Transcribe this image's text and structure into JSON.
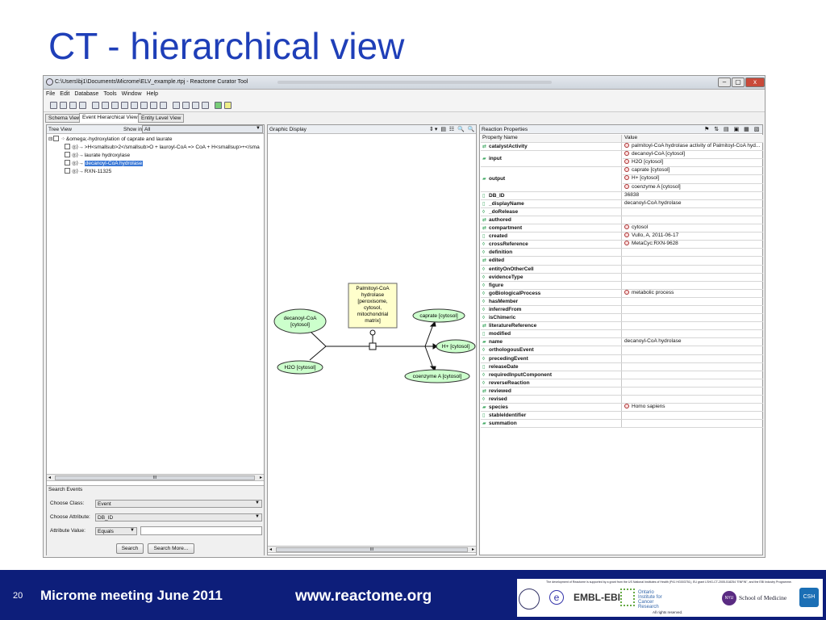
{
  "slide": {
    "title": "CT - hierarchical view",
    "page_number": "20",
    "meeting": "Microme meeting June 2011",
    "url": "www.reactome.org"
  },
  "window": {
    "title": "C:\\Users\\bj1\\Documents\\Microme\\ELV_example.rtpj - Reactome Curator Tool",
    "min": "–",
    "max": "▢",
    "close": "x"
  },
  "menu": [
    "File",
    "Edit",
    "Database",
    "Tools",
    "Window",
    "Help"
  ],
  "tabs": [
    "Schema View",
    "Event Hierarchical View",
    "Entity Level View"
  ],
  "tree_view": {
    "header": "Tree View",
    "show_in_label": "Show in",
    "show_in_value": "All",
    "items": [
      {
        "label": "&omega;-hydroxylation of caprate and laurate",
        "level": 0,
        "selected": false
      },
      {
        "label": ">H<smallsub>2</smallsub>O + lauroyl-CoA => CoA + H<smallsup>+</sma",
        "level": 1,
        "selected": false
      },
      {
        "label": "laurate hydroxylase",
        "level": 1,
        "selected": false
      },
      {
        "label": "decanoyl-CoA hydrolase",
        "level": 1,
        "selected": true
      },
      {
        "label": "RXN-11325",
        "level": 1,
        "selected": false
      }
    ],
    "scroll_thumb": "III"
  },
  "search": {
    "title": "Search Events",
    "class_label": "Choose Class:",
    "class_value": "Event",
    "attr_label": "Choose Attribute:",
    "attr_value": "DB_ID",
    "value_label": "Attribute Value:",
    "operator": "Equals",
    "value": "",
    "search_btn": "Search",
    "search_more_btn": "Search More..."
  },
  "graphic": {
    "header": "Graphic Display",
    "scroll_thumb": "III",
    "nodes": {
      "catalyst": [
        "Palmitoyl-CoA",
        "hydrolase",
        "[peroxisome,",
        "cytosol,",
        "mitochondrial",
        "matrix]"
      ],
      "input1": [
        "decanoyl-CoA",
        "[cytosol]"
      ],
      "input2": "H2O [cytosol]",
      "output1": "caprate [cytosol]",
      "output2": "H+ [cytosol]",
      "output3": "coenzyme A [cytosol]"
    }
  },
  "properties": {
    "header": "Reaction Properties",
    "col_name": "Property Name",
    "col_value": "Value",
    "rows": [
      {
        "name": "catalystActivity",
        "icon": "⇄",
        "values": [
          "palmitoyl-CoA hydrolase activity of Palmitoyl-CoA hyd..."
        ],
        "inst": true
      },
      {
        "name": "input",
        "icon": "▰",
        "values": [
          "decanoyl-CoA [cytosol]",
          "H2O [cytosol]"
        ],
        "inst": true
      },
      {
        "name": "output",
        "icon": "▰",
        "values": [
          "caprate [cytosol]",
          "H+ [cytosol]",
          "coenzyme A [cytosol]"
        ],
        "inst": true
      },
      {
        "name": "DB_ID",
        "icon": "▯",
        "values": [
          "36838"
        ],
        "inst": false
      },
      {
        "name": "_displayName",
        "icon": "▯",
        "values": [
          "decanoyl-CoA hydrolase"
        ],
        "inst": false
      },
      {
        "name": "_doRelease",
        "icon": "◊",
        "values": [
          ""
        ],
        "inst": false
      },
      {
        "name": "authored",
        "icon": "⇄",
        "values": [
          ""
        ],
        "inst": false
      },
      {
        "name": "compartment",
        "icon": "⇄",
        "values": [
          "cytosol"
        ],
        "inst": true
      },
      {
        "name": "created",
        "icon": "▯",
        "values": [
          "Vullo, A, 2011-06-17"
        ],
        "inst": true
      },
      {
        "name": "crossReference",
        "icon": "◊",
        "values": [
          "MetaCyc:RXN-9628"
        ],
        "inst": true
      },
      {
        "name": "definition",
        "icon": "◊",
        "values": [
          ""
        ],
        "inst": false
      },
      {
        "name": "edited",
        "icon": "⇄",
        "values": [
          ""
        ],
        "inst": false
      },
      {
        "name": "entityOnOtherCell",
        "icon": "◊",
        "values": [
          ""
        ],
        "inst": false
      },
      {
        "name": "evidenceType",
        "icon": "◊",
        "values": [
          ""
        ],
        "inst": false
      },
      {
        "name": "figure",
        "icon": "◊",
        "values": [
          ""
        ],
        "inst": false
      },
      {
        "name": "goBiologicalProcess",
        "icon": "◊",
        "values": [
          "metabolic process"
        ],
        "inst": true
      },
      {
        "name": "hasMember",
        "icon": "◊",
        "values": [
          ""
        ],
        "inst": false
      },
      {
        "name": "inferredFrom",
        "icon": "◊",
        "values": [
          ""
        ],
        "inst": false
      },
      {
        "name": "isChimeric",
        "icon": "◊",
        "values": [
          ""
        ],
        "inst": false
      },
      {
        "name": "literatureReference",
        "icon": "⇄",
        "values": [
          ""
        ],
        "inst": false
      },
      {
        "name": "modified",
        "icon": "▯",
        "values": [
          ""
        ],
        "inst": false
      },
      {
        "name": "name",
        "icon": "▰",
        "values": [
          "decanoyl-CoA hydrolase"
        ],
        "inst": false
      },
      {
        "name": "orthologousEvent",
        "icon": "◊",
        "values": [
          ""
        ],
        "inst": false
      },
      {
        "name": "precedingEvent",
        "icon": "◊",
        "values": [
          ""
        ],
        "inst": false
      },
      {
        "name": "releaseDate",
        "icon": "▯",
        "values": [
          ""
        ],
        "inst": false
      },
      {
        "name": "requiredInputComponent",
        "icon": "◊",
        "values": [
          ""
        ],
        "inst": false
      },
      {
        "name": "reverseReaction",
        "icon": "◊",
        "values": [
          ""
        ],
        "inst": false
      },
      {
        "name": "reviewed",
        "icon": "⇄",
        "values": [
          ""
        ],
        "inst": false
      },
      {
        "name": "revised",
        "icon": "◊",
        "values": [
          ""
        ],
        "inst": false
      },
      {
        "name": "species",
        "icon": "▰",
        "values": [
          "Homo sapiens"
        ],
        "inst": true
      },
      {
        "name": "stableIdentifier",
        "icon": "▯",
        "values": [
          ""
        ],
        "inst": false
      },
      {
        "name": "summation",
        "icon": "▰",
        "values": [
          ""
        ],
        "inst": false
      }
    ]
  },
  "logos": {
    "funding": "The development of Reactome is supported by a grant from the US National Institutes of Health (P41 HG003751), EU grant LSHG-CT-2005-518254 \"ENFIN\", and the EBI Industry Programme.",
    "rights": "All rights reserved.",
    "ebi": "EMBL-EBI",
    "oicr": "Ontario Institute for Cancer Research",
    "nyu": "NYU",
    "nyu_school": "School of Medicine",
    "csh": "CSH",
    "e": "e"
  }
}
